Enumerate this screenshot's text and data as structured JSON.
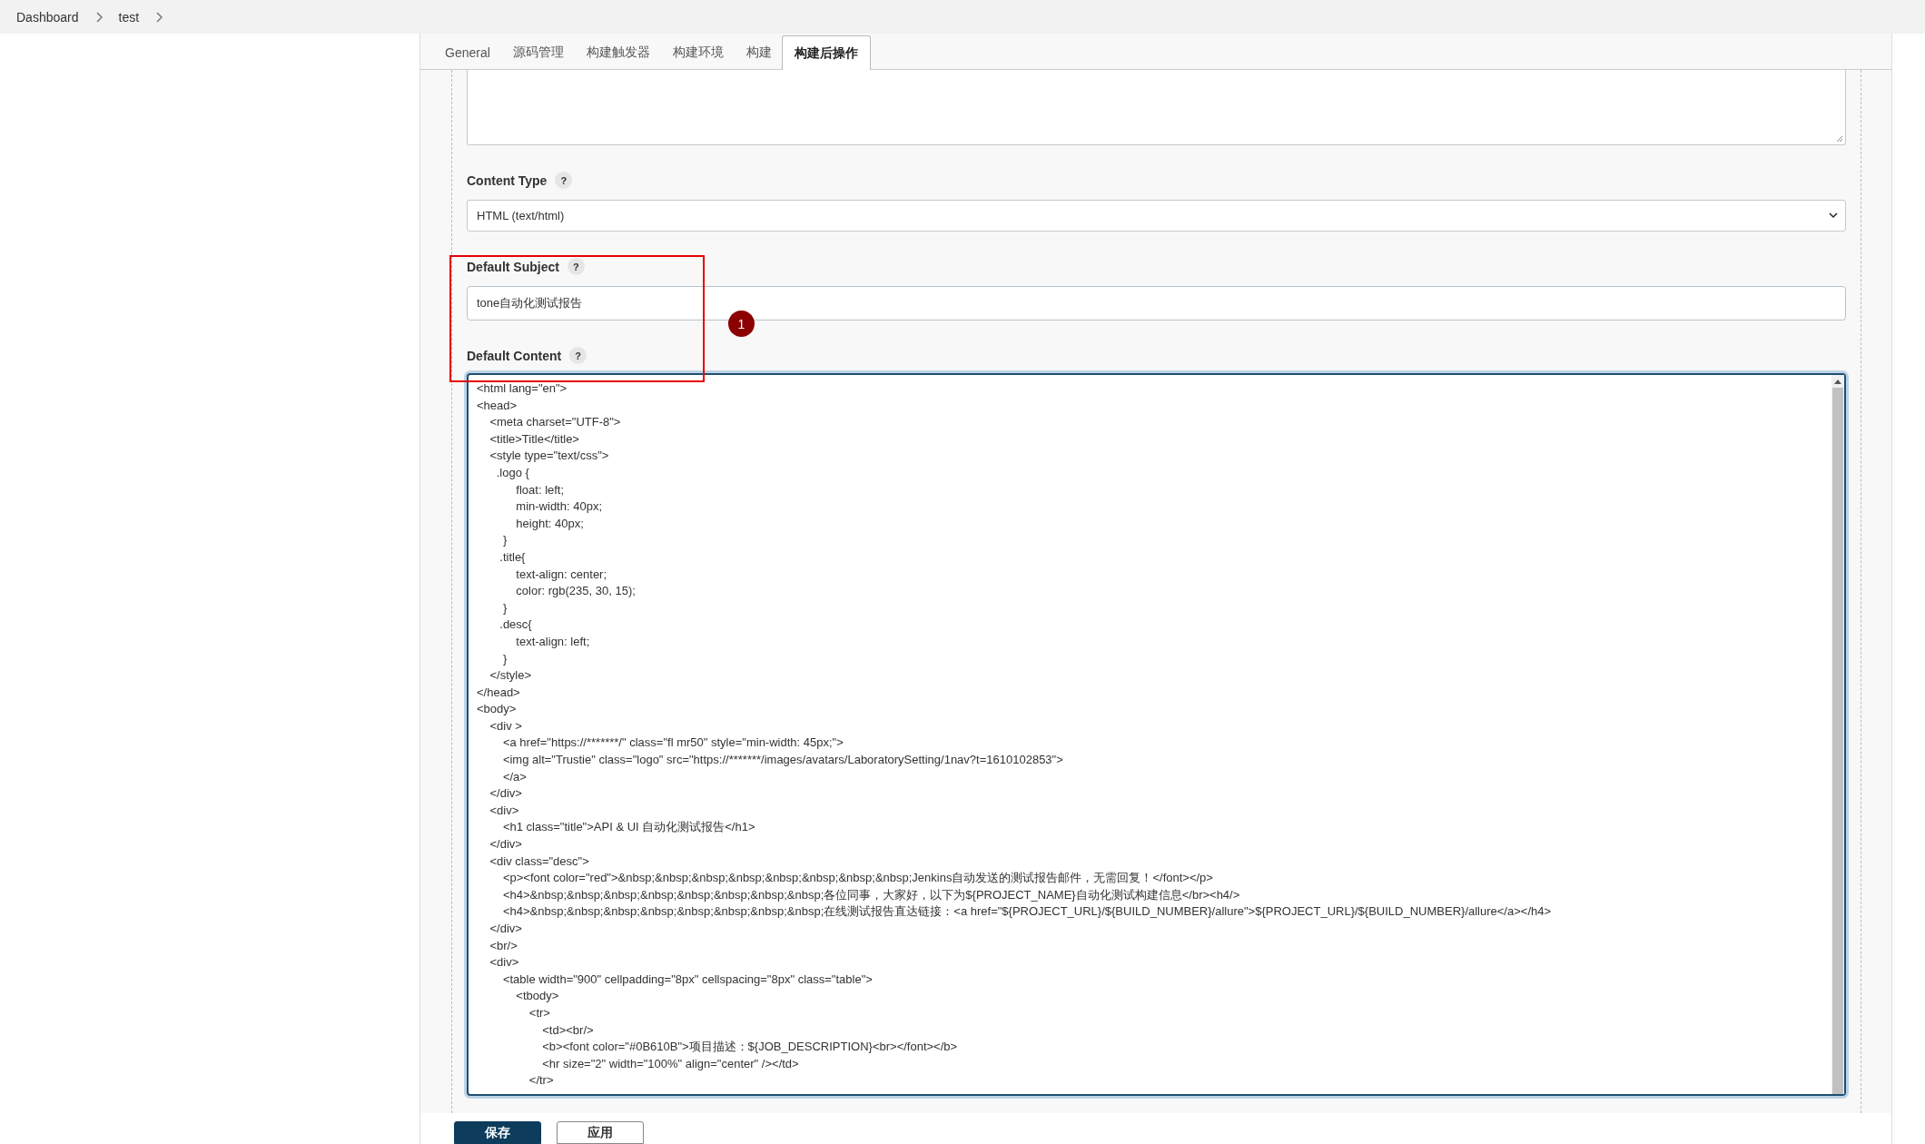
{
  "breadcrumb": [
    {
      "label": "Dashboard"
    },
    {
      "label": "test"
    }
  ],
  "tabs": [
    {
      "label": "General",
      "selected": false
    },
    {
      "label": "源码管理",
      "selected": false
    },
    {
      "label": "构建触发器",
      "selected": false
    },
    {
      "label": "构建环境",
      "selected": false
    },
    {
      "label": "构建",
      "selected": false
    },
    {
      "label": "构建后操作",
      "selected": true
    }
  ],
  "fields": [
    {
      "kind": "select",
      "label": "Content Type",
      "help": "?",
      "value": "HTML (text/html)"
    },
    {
      "kind": "input",
      "label": "Default Subject",
      "help": "?",
      "value": "tone自动化测试报告"
    },
    {
      "kind": "code",
      "label": "Default Content",
      "help": "?",
      "lines": [
        "<html lang=\"en\">",
        "<head>",
        "    <meta charset=\"UTF-8\">",
        "    <title>Title</title>",
        "    <style type=\"text/css\">",
        "      .logo {",
        "            float: left;",
        "            min-width: 40px;",
        "            height: 40px;",
        "        }",
        "       .title{",
        "            text-align: center;",
        "            color: rgb(235, 30, 15);",
        "        }",
        "       .desc{",
        "            text-align: left;",
        "        }",
        "    </style>",
        "</head>",
        "<body>",
        "    <div >",
        "        <a href=\"https://*******/\" class=\"fl mr50\" style=\"min-width: 45px;\">",
        "        <img alt=\"Trustie\" class=\"logo\" src=\"https://*******/images/avatars/LaboratorySetting/1nav?t=1610102853\">",
        "        </a>",
        "    </div>",
        "    <div>",
        "        <h1 class=\"title\">API & UI 自动化测试报告</h1>",
        "    </div>",
        "    <div class=\"desc\">",
        "        <p><font color=\"red\">&nbsp;&nbsp;&nbsp;&nbsp;&nbsp;&nbsp;&nbsp;&nbsp;Jenkins自动发送的测试报告邮件，无需回复！</font></p>",
        "        <h4>&nbsp;&nbsp;&nbsp;&nbsp;&nbsp;&nbsp;&nbsp;&nbsp;各位同事，大家好，以下为${PROJECT_NAME}自动化测试构建信息</br><h4/>",
        "        <h4>&nbsp;&nbsp;&nbsp;&nbsp;&nbsp;&nbsp;&nbsp;&nbsp;在线测试报告直达链接：<a href=\"${PROJECT_URL}/${BUILD_NUMBER}/allure\">${PROJECT_URL}/${BUILD_NUMBER}/allure</a></h4>",
        "    </div>",
        "    <br/>",
        "    <div>",
        "        <table width=\"900\" cellpadding=\"8px\" cellspacing=\"8px\" class=\"table\">",
        "            <tbody>",
        "                <tr>",
        "                    <td><br/>",
        "                    <b><font color=\"#0B610B\">项目描述：${JOB_DESCRIPTION}<br></font></b>",
        "                    <hr size=\"2\" width=\"100%\" align=\"center\" /></td>",
        "                </tr>"
      ]
    }
  ],
  "annotation": {
    "number": "1"
  },
  "buttons": [
    {
      "label": "保存",
      "kind": "primary"
    },
    {
      "label": "应用",
      "kind": "secondary"
    }
  ]
}
